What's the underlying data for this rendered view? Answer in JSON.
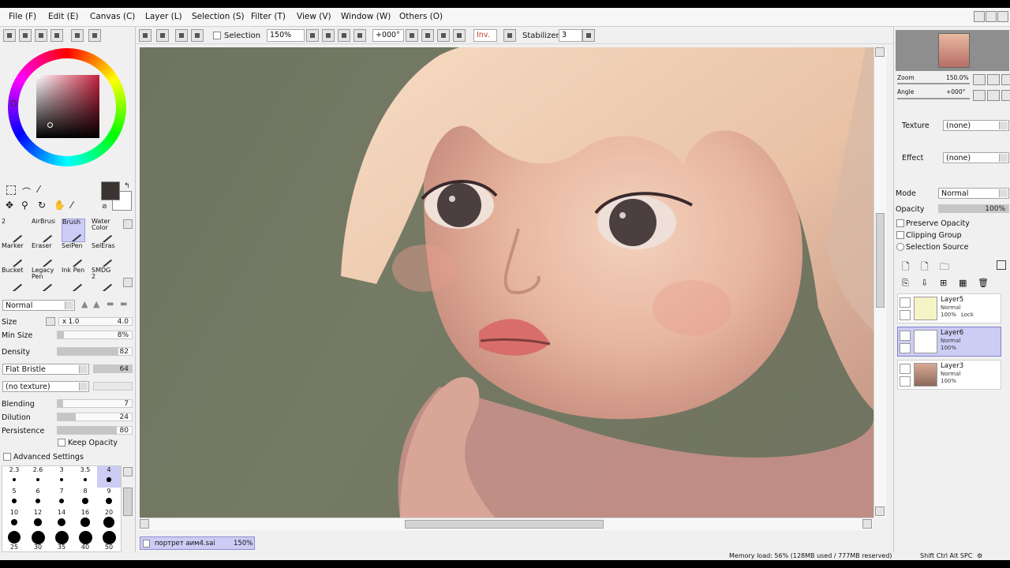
{
  "menu": {
    "items": [
      "File (F)",
      "Edit (E)",
      "Canvas (C)",
      "Layer (L)",
      "Selection (S)",
      "Filter (T)",
      "View (V)",
      "Window (W)",
      "Others (O)"
    ]
  },
  "toolbar": {
    "selection_label": "Selection",
    "zoom": "150%",
    "angle": "+000°",
    "invert_label": "Inv.",
    "stabilizer_label": "Stabilizer",
    "stabilizer_value": "3"
  },
  "tools": [
    {
      "label": "2",
      "active": false
    },
    {
      "label": "AirBrush",
      "active": false
    },
    {
      "label": "Brush",
      "active": true
    },
    {
      "label": "Water Color",
      "active": false
    },
    {
      "label": "Marker",
      "active": false
    },
    {
      "label": "Eraser",
      "active": false
    },
    {
      "label": "SelPen",
      "active": false
    },
    {
      "label": "SelEras",
      "active": false
    },
    {
      "label": "Bucket",
      "active": false
    },
    {
      "label": "Legacy Pen",
      "active": false
    },
    {
      "label": "Ink Pen",
      "active": false
    },
    {
      "label": "SMDG 2",
      "active": false
    }
  ],
  "brush": {
    "blend_mode": "Normal",
    "size_label": "Size",
    "size_multiplier": "x 1.0",
    "size_value": "4.0",
    "min_size_label": "Min Size",
    "min_size_value": "8%",
    "density_label": "Density",
    "density_value": "82",
    "shape": "Flat Bristle",
    "shape_value": "64",
    "texture": "(no texture)",
    "blending_label": "Blending",
    "blending_value": "7",
    "dilution_label": "Dilution",
    "dilution_value": "24",
    "persistence_label": "Persistence",
    "persistence_value": "80",
    "keep_opacity_label": "Keep Opacity",
    "advanced_label": "Advanced Settings",
    "fills": {
      "min_size": 0.08,
      "density": 0.82,
      "blending": 0.07,
      "dilution": 0.24,
      "persistence": 0.8
    }
  },
  "brush_sizes": {
    "rows": [
      [
        "2.3",
        "2.6",
        "3",
        "3.5",
        "4"
      ],
      [
        "5",
        "6",
        "7",
        "8",
        "9"
      ],
      [
        "10",
        "12",
        "14",
        "16",
        "20"
      ],
      [
        "25",
        "30",
        "35",
        "40",
        "50"
      ]
    ],
    "selected": "4"
  },
  "colors": {
    "foreground": "#3a3432",
    "background": "#ffffff",
    "accent": "#ccccf4"
  },
  "navigator": {
    "zoom_label": "Zoom",
    "zoom_value": "150.0%",
    "angle_label": "Angle",
    "angle_value": "+000°"
  },
  "layer_props": {
    "texture_label": "Texture",
    "texture_value": "(none)",
    "effect_label": "Effect",
    "effect_value": "(none)",
    "mode_label": "Mode",
    "mode_value": "Normal",
    "opacity_label": "Opacity",
    "opacity_value": "100%",
    "preserve_opacity": "Preserve Opacity",
    "clipping_group": "Clipping Group",
    "selection_source": "Selection Source"
  },
  "layers": [
    {
      "name": "Layer5",
      "mode": "Normal",
      "opacity": "100%",
      "lock": "Lock",
      "selected": false
    },
    {
      "name": "Layer6",
      "mode": "Normal",
      "opacity": "100%",
      "lock": "",
      "selected": true
    },
    {
      "name": "Layer3",
      "mode": "Normal",
      "opacity": "100%",
      "lock": "",
      "selected": false
    }
  ],
  "document": {
    "name": "портрет аим4.sai",
    "zoom": "150%"
  },
  "status": {
    "memory": "Memory load: 56% (128MB used / 777MB reserved)",
    "keys": "Shift Ctrl Alt SPC"
  }
}
